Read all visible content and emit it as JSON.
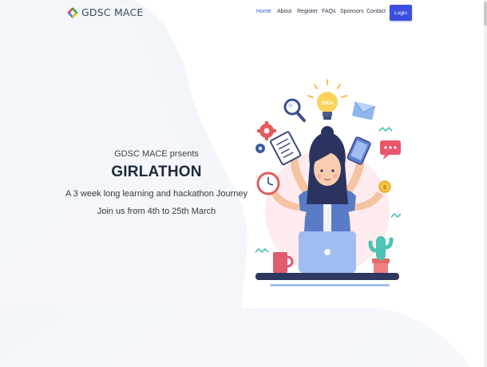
{
  "brand": {
    "name": "GDSC MACE",
    "colors": [
      "#4285f4",
      "#ea4335",
      "#fbbc05",
      "#34a853"
    ]
  },
  "nav": {
    "links": [
      {
        "label": "Home",
        "active": true
      },
      {
        "label": "About",
        "active": false
      },
      {
        "label": "Register",
        "active": false
      },
      {
        "label": "FAQs",
        "active": false
      },
      {
        "label": "Sponsors",
        "active": false
      },
      {
        "label": "Contact",
        "active": false
      }
    ],
    "login_label": "Login",
    "accent": "#3a4fe0"
  },
  "hero": {
    "presents": "GDSC MACE prsents",
    "title": "GIRLATHON",
    "tagline": "A 3 week long learning and hackathon Journey",
    "dates": "Join us from 4th to 25th March"
  },
  "illustration": {
    "name": "multitasking-woman-illustration",
    "icons": [
      "magnifier-icon",
      "lightbulb-icon",
      "envelope-icon",
      "gear-icon",
      "document-icon",
      "phone-icon",
      "chat-bubble-icon",
      "clock-icon",
      "coin-icon",
      "mug-icon",
      "cactus-icon",
      "laptop-icon"
    ]
  }
}
